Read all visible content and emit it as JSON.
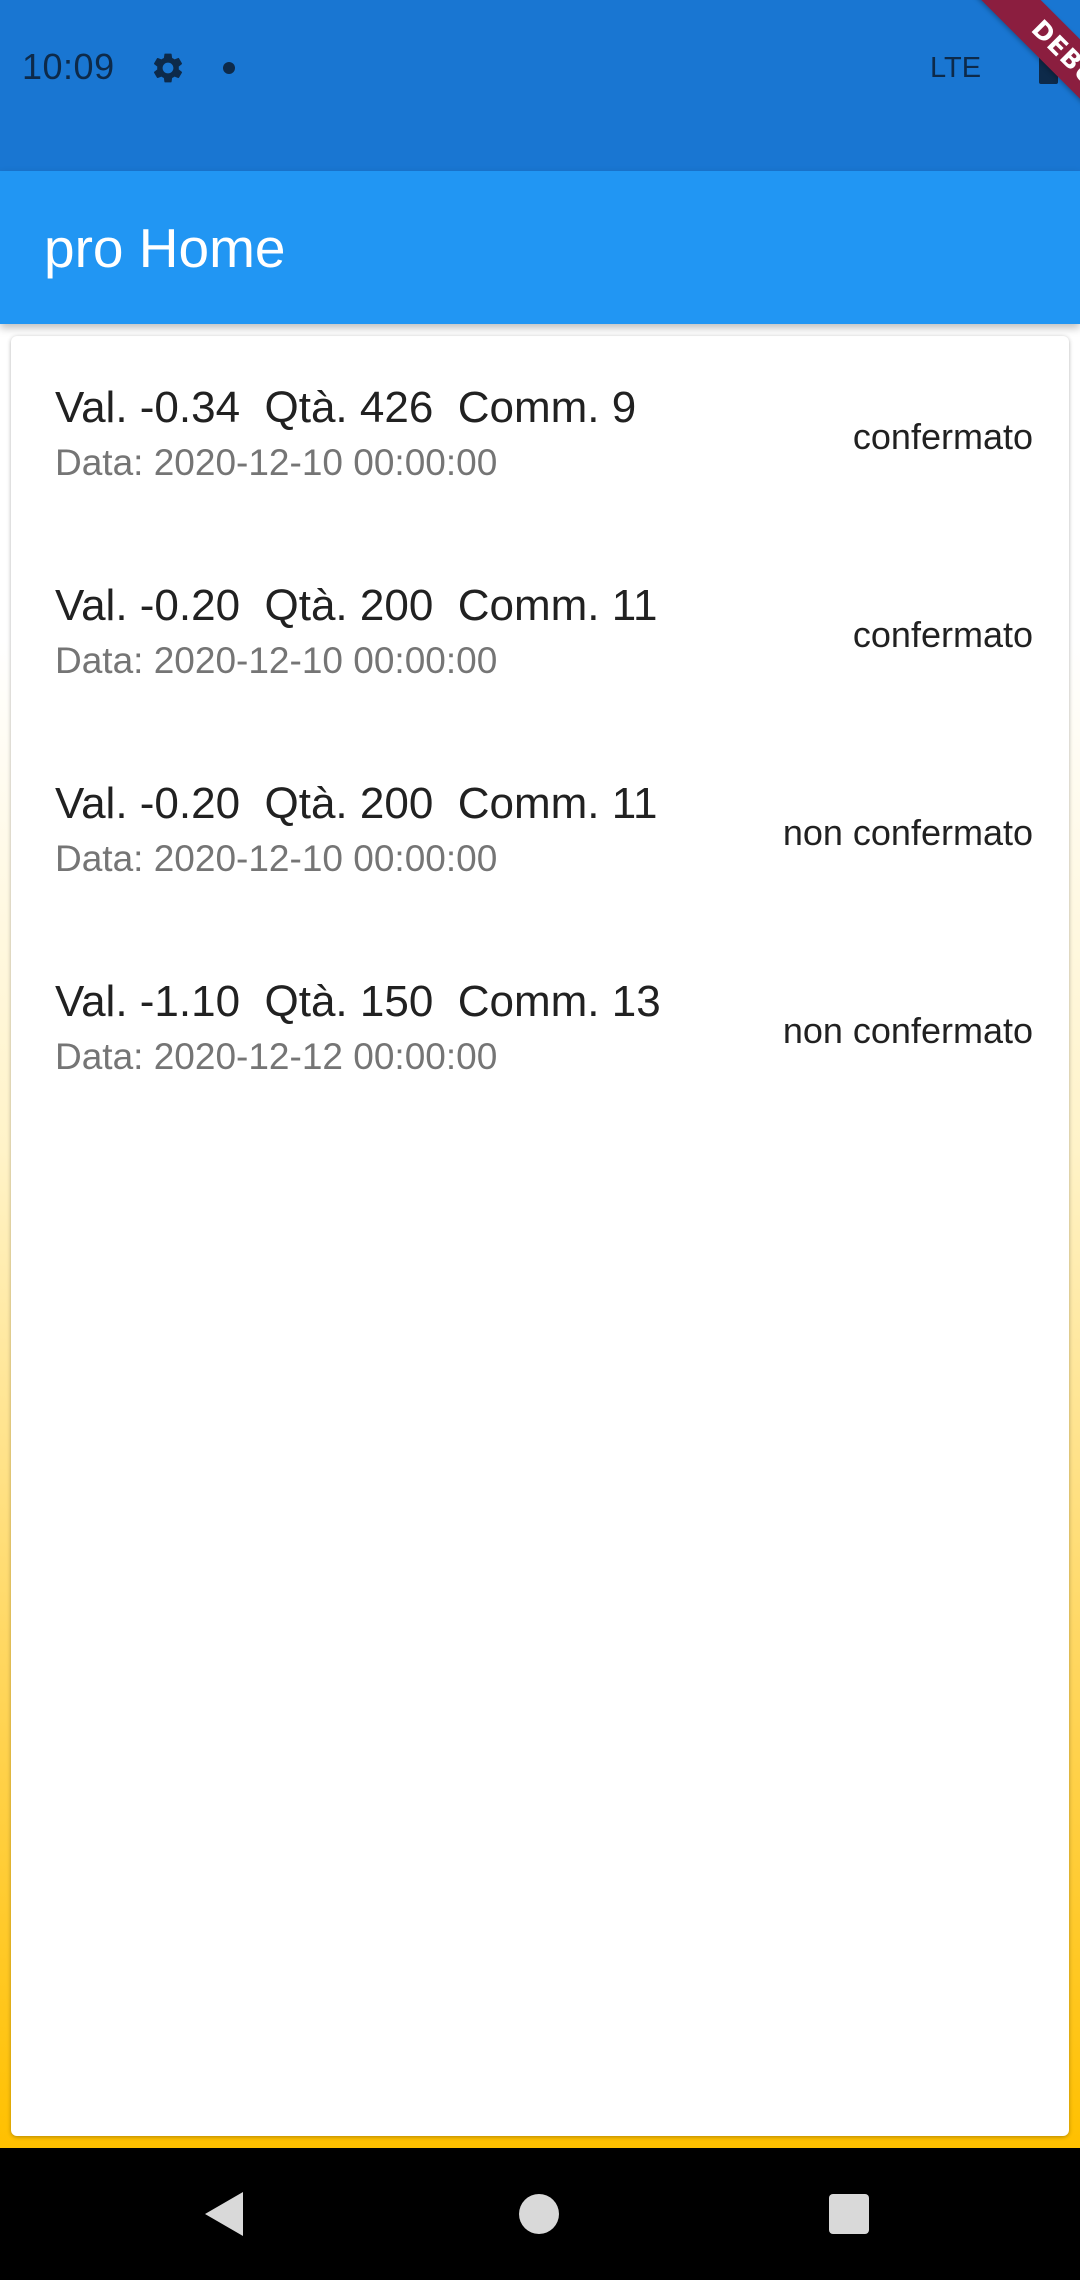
{
  "status_bar": {
    "time": "10:09",
    "network": "LTE",
    "icons": [
      "gear-icon",
      "notification-dot-icon",
      "battery-icon"
    ]
  },
  "debug_banner": "DEBUG",
  "app_bar": {
    "title": "pro Home"
  },
  "items": [
    {
      "title": "Val. -0.34  Qtà. 426  Comm. 9",
      "subtitle": "Data: 2020-12-10 00:00:00",
      "status": "confermato"
    },
    {
      "title": "Val. -0.20  Qtà. 200  Comm. 11",
      "subtitle": "Data: 2020-12-10 00:00:00",
      "status": "confermato"
    },
    {
      "title": "Val. -0.20  Qtà. 200  Comm. 11",
      "subtitle": "Data: 2020-12-10 00:00:00",
      "status": "non confermato"
    },
    {
      "title": "Val. -1.10  Qtà. 150  Comm. 13",
      "subtitle": "Data: 2020-12-12 00:00:00",
      "status": "non confermato"
    }
  ],
  "nav_bar": {
    "icons": [
      "back-icon",
      "home-icon",
      "recent-apps-icon"
    ]
  },
  "colors": {
    "status_bar": "#1976d2",
    "app_bar": "#2196f3",
    "debug_banner": "#8b1e3f",
    "background_gradient_end": "#ffc000"
  }
}
